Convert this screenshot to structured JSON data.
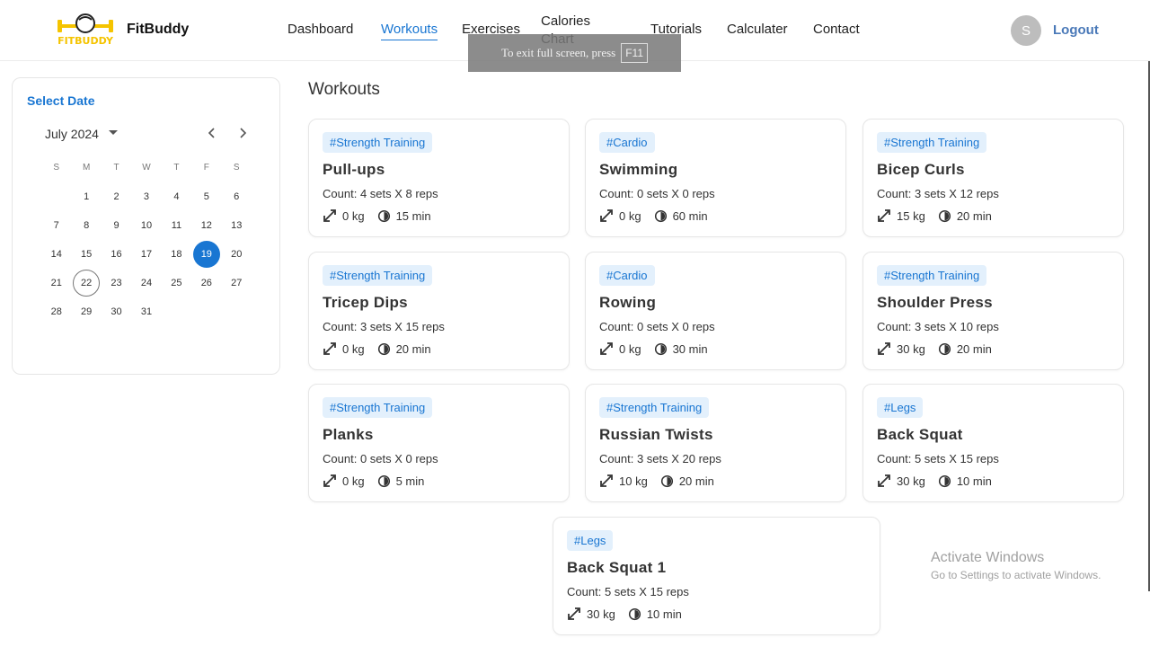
{
  "brand": {
    "name": "FitBuddy",
    "logo_text": "FITBUDDY"
  },
  "nav": {
    "items": [
      "Dashboard",
      "Workouts",
      "Exercises",
      "Calories Chart",
      "Tutorials",
      "Calculater",
      "Contact"
    ],
    "active": "Workouts"
  },
  "user": {
    "avatar_initial": "S",
    "logout_label": "Logout"
  },
  "fullscreen_toast": {
    "text": "To exit full screen, press",
    "key": "F11"
  },
  "calendar": {
    "title": "Select Date",
    "month_label": "July 2024",
    "weekdays": [
      "S",
      "M",
      "T",
      "W",
      "T",
      "F",
      "S"
    ],
    "weeks": [
      [
        "",
        "1",
        "2",
        "3",
        "4",
        "5",
        "6"
      ],
      [
        "7",
        "8",
        "9",
        "10",
        "11",
        "12",
        "13"
      ],
      [
        "14",
        "15",
        "16",
        "17",
        "18",
        "19",
        "20"
      ],
      [
        "21",
        "22",
        "23",
        "24",
        "25",
        "26",
        "27"
      ],
      [
        "28",
        "29",
        "30",
        "31",
        "",
        "",
        ""
      ]
    ],
    "selected_day": "19",
    "today_day": "22"
  },
  "workouts": {
    "title": "Workouts",
    "count_prefix": "Count:",
    "cards": [
      {
        "tag": "#Strength Training",
        "name": "Pull-ups",
        "count": "4 sets X 8 reps",
        "weight": "0 kg",
        "duration": "15 min"
      },
      {
        "tag": "#Cardio",
        "name": "Swimming",
        "count": "0 sets X 0 reps",
        "weight": "0 kg",
        "duration": "60 min"
      },
      {
        "tag": "#Strength Training",
        "name": "Bicep Curls",
        "count": "3 sets X 12 reps",
        "weight": "15 kg",
        "duration": "20 min"
      },
      {
        "tag": "#Strength Training",
        "name": "Tricep Dips",
        "count": "3 sets X 15 reps",
        "weight": "0 kg",
        "duration": "20 min"
      },
      {
        "tag": "#Cardio",
        "name": "Rowing",
        "count": "0 sets X 0 reps",
        "weight": "0 kg",
        "duration": "30 min"
      },
      {
        "tag": "#Strength Training",
        "name": "Shoulder Press",
        "count": "3 sets X 10 reps",
        "weight": "30 kg",
        "duration": "20 min"
      },
      {
        "tag": "#Strength Training",
        "name": "Planks",
        "count": "0 sets X 0 reps",
        "weight": "0 kg",
        "duration": "5 min"
      },
      {
        "tag": "#Strength Training",
        "name": "Russian Twists",
        "count": "3 sets X 20 reps",
        "weight": "10 kg",
        "duration": "20 min"
      },
      {
        "tag": "#Legs",
        "name": "Back Squat",
        "count": "5 sets X 15 reps",
        "weight": "30 kg",
        "duration": "10 min"
      },
      {
        "tag": "#Legs",
        "name": "Back Squat 1",
        "count": "5 sets X 15 reps",
        "weight": "30 kg",
        "duration": "10 min"
      }
    ]
  },
  "watermark": {
    "line1": "Activate Windows",
    "line2": "Go to Settings to activate Windows."
  },
  "colors": {
    "accent": "#1976d2",
    "tag_bg": "#e3f0fc",
    "logo_yellow": "#f5c400"
  }
}
